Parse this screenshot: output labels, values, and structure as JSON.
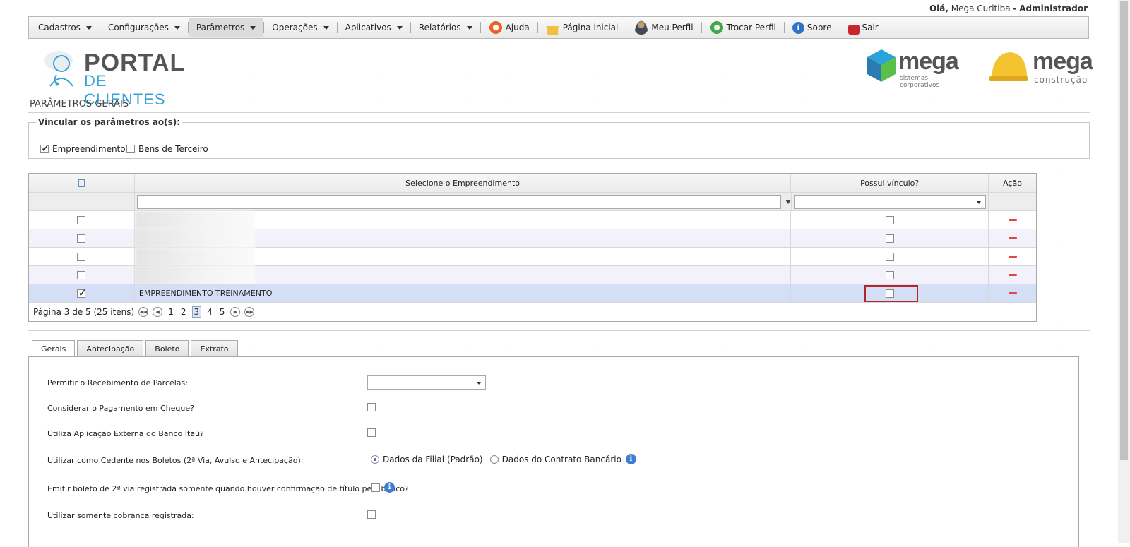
{
  "header": {
    "greeting": "Olá,",
    "user": "Mega Curitiba",
    "dash": "-",
    "role": "Administrador"
  },
  "menu": {
    "items": [
      {
        "label": "Cadastros"
      },
      {
        "label": "Configurações"
      },
      {
        "label": "Parâmetros"
      },
      {
        "label": "Operações"
      },
      {
        "label": "Aplicativos"
      },
      {
        "label": "Relatórios"
      },
      {
        "label": "Ajuda"
      },
      {
        "label": "Página inicial"
      },
      {
        "label": "Meu Perfil"
      },
      {
        "label": "Trocar Perfil"
      },
      {
        "label": "Sobre"
      },
      {
        "label": "Sair"
      }
    ]
  },
  "logos": {
    "portal_line1": "PORTAL",
    "portal_line2": "DE CLIENTES",
    "mega1_word": "mega",
    "mega1_sub": "sistemas corporativos",
    "mega2_word": "mega",
    "mega2_sub": "construção"
  },
  "page": {
    "title": "PARÂMETROS GERAIS"
  },
  "vincular": {
    "legend": "Vincular os parâmetros ao(s):",
    "opt1": "Empreendimento",
    "opt1_checked": true,
    "opt2": "Bens de Terceiro",
    "opt2_checked": false
  },
  "grid": {
    "col_select": "Selecione o Empreendimento",
    "col_vinculo": "Possui vínculo?",
    "col_acao": "Ação",
    "rows": [
      {
        "name": "",
        "checked": false
      },
      {
        "name": "",
        "checked": false
      },
      {
        "name": "",
        "checked": false
      },
      {
        "name": "",
        "checked": false
      },
      {
        "name": "EMPREENDIMENTO TREINAMENTO",
        "checked": true
      }
    ],
    "pager_text": "Página 3 de 5 (25 itens)",
    "pages": [
      "1",
      "2",
      "3",
      "4",
      "5"
    ],
    "current_page": "3"
  },
  "tabs": [
    "Gerais",
    "Antecipação",
    "Boleto",
    "Extrato"
  ],
  "form": {
    "f1": "Permitir o Recebimento de Parcelas:",
    "f2": "Considerar o Pagamento em Cheque?",
    "f3": "Utiliza Aplicação Externa do Banco Itaú?",
    "f4": "Utilizar como Cedente nos Boletos (2ª Via, Avulso e Antecipação):",
    "f4_opt1": "Dados da Filial (Padrão)",
    "f4_opt2": "Dados do Contrato Bancário",
    "f5": "Emitir boleto de 2ª via registrada somente quando houver confirmação de título pelo banco?",
    "f6": "Utilizar somente cobrança registrada:"
  },
  "icons": {
    "ajuda": "lifebuoy-icon",
    "home": "home-icon",
    "perfil": "user-icon",
    "trocar": "refresh-icon",
    "sobre": "info-icon",
    "sair": "lock-icon"
  }
}
